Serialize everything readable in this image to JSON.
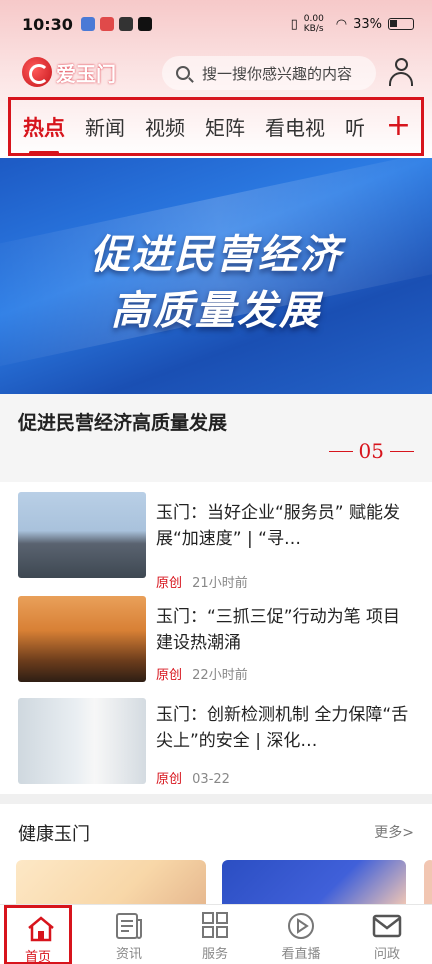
{
  "status_bar": {
    "time": "10:30",
    "speed": "0.00 KB/s",
    "battery": "33%"
  },
  "app": {
    "name": "爱玉门"
  },
  "search": {
    "placeholder": "搜一搜你感兴趣的内容"
  },
  "tabs": [
    {
      "label": "热点",
      "active": true
    },
    {
      "label": "新闻"
    },
    {
      "label": "视频"
    },
    {
      "label": "矩阵"
    },
    {
      "label": "看电视"
    },
    {
      "label": "听"
    }
  ],
  "banner": {
    "line1": "促进民营经济",
    "line2": "高质量发展"
  },
  "headline": {
    "title": "促进民营经济高质量发展",
    "page": "05"
  },
  "news": [
    {
      "title": "玉门：当好企业“服务员” 赋能发展“加速度” | “寻…",
      "tag": "原创",
      "time": "21小时前"
    },
    {
      "title": "玉门：“三抓三促”行动为笔 项目建设热潮涌",
      "tag": "原创",
      "time": "22小时前"
    },
    {
      "title": "玉门：创新检测机制 全力保障“舌尖上”的安全 | 深化…",
      "tag": "原创",
      "time": "03-22"
    }
  ],
  "health": {
    "title": "健康玉门",
    "more": "更多>"
  },
  "bottom_nav": [
    {
      "label": "首页",
      "icon": "home-icon",
      "active": true
    },
    {
      "label": "资讯",
      "icon": "news-icon"
    },
    {
      "label": "服务",
      "icon": "grid-icon"
    },
    {
      "label": "看直播",
      "icon": "play-icon"
    },
    {
      "label": "问政",
      "icon": "mail-icon"
    }
  ],
  "colors": {
    "accent": "#d7141c",
    "banner": "#2d7ee6"
  }
}
